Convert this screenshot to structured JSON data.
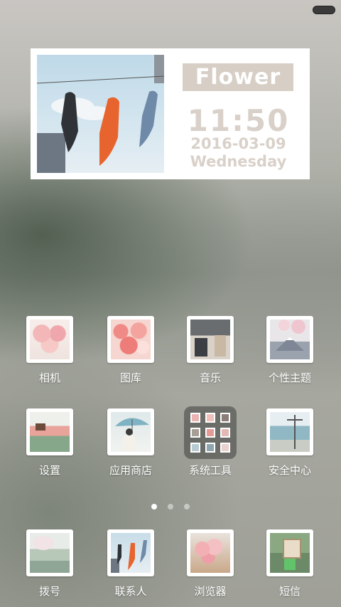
{
  "widget": {
    "brand": "Flower",
    "time": "11:50",
    "date": "2016-03-09",
    "day": "Wednesday",
    "text_color": "#d9d1c9",
    "brand_bg": "#d7cec6"
  },
  "apps": {
    "row1": [
      "相机",
      "图库",
      "音乐",
      "个性主题"
    ],
    "row2": [
      "设置",
      "应用商店",
      "系统工具",
      "安全中心"
    ],
    "dock": [
      "拨号",
      "联系人",
      "浏览器",
      "短信"
    ]
  },
  "icons": {
    "camera": "pink-flowers-photo-icon",
    "gallery": "rose-bouquet-photo-icon",
    "music": "street-shop-photo-icon",
    "theme": "mount-fuji-photo-icon",
    "settings": "flower-field-photo-icon",
    "store": "umbrella-girl-photo-icon",
    "tools": "folder-icon",
    "security": "seaside-pole-photo-icon",
    "dialer": "cherry-tree-photo-icon",
    "contacts": "koi-flags-photo-icon",
    "browser": "flower-basket-photo-icon",
    "sms": "signboard-photo-icon"
  },
  "pager": {
    "pages": 3,
    "current": 1
  }
}
